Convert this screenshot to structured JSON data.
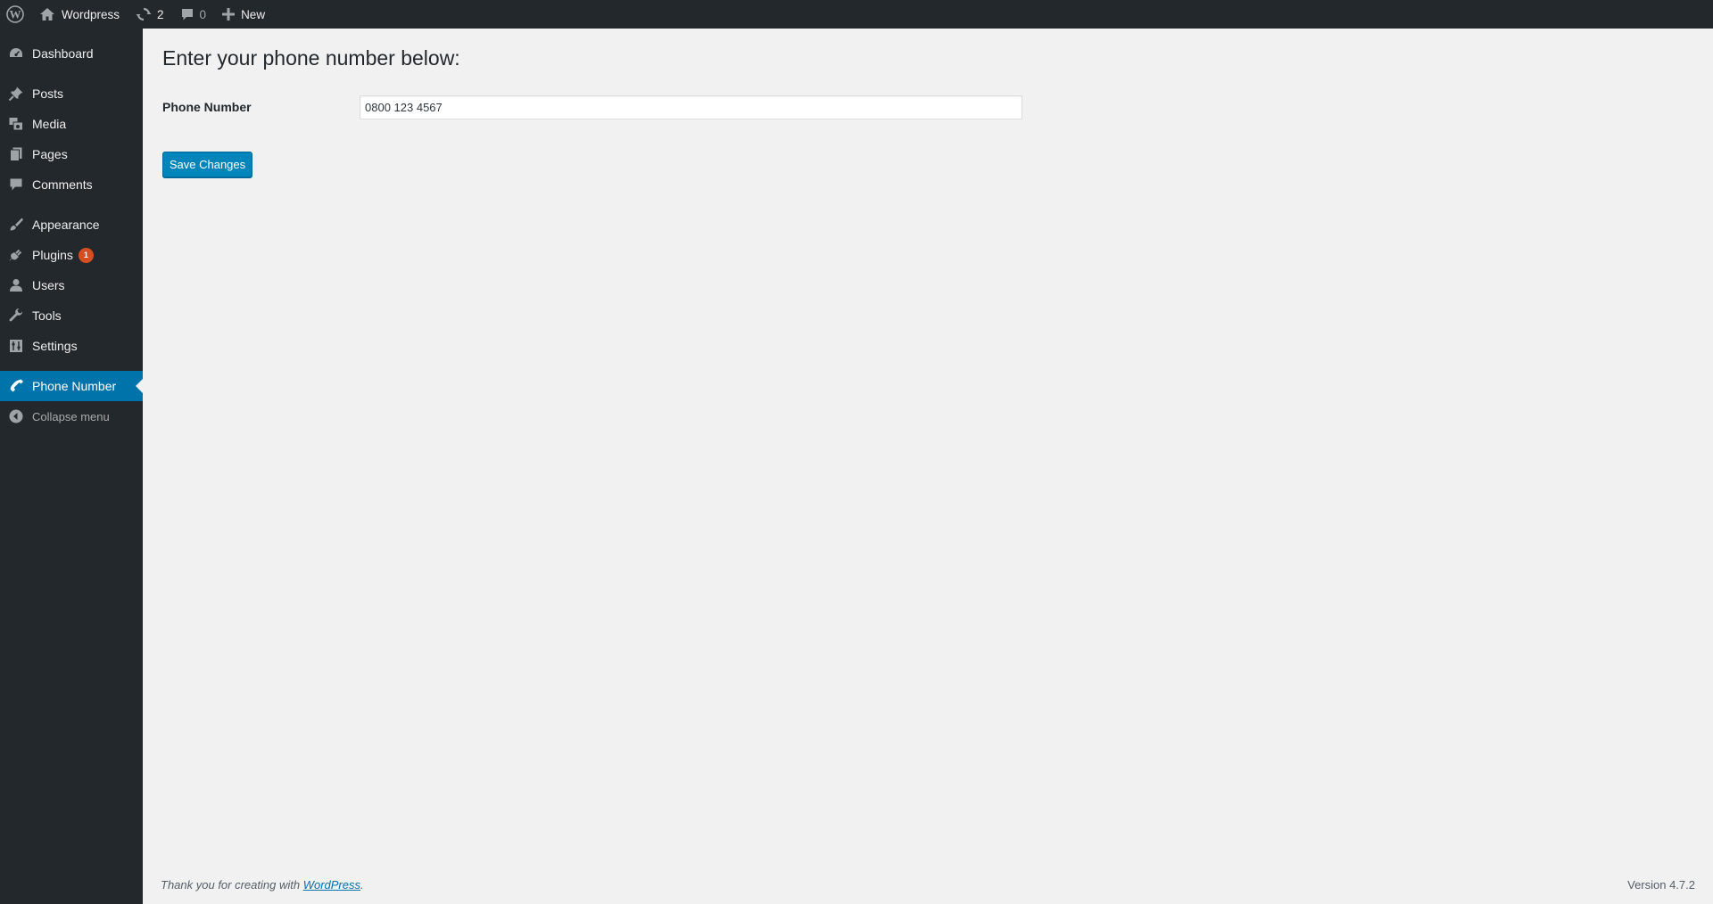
{
  "admin_bar": {
    "site_name": "Wordpress",
    "updates_count": "2",
    "comments_count": "0",
    "new_label": "New"
  },
  "sidebar": {
    "items": [
      {
        "label": "Dashboard",
        "icon": "dashboard-icon"
      },
      {
        "label": "Posts",
        "icon": "pushpin-icon"
      },
      {
        "label": "Media",
        "icon": "media-icon"
      },
      {
        "label": "Pages",
        "icon": "pages-icon"
      },
      {
        "label": "Comments",
        "icon": "comment-bubble-icon"
      },
      {
        "label": "Appearance",
        "icon": "paintbrush-icon"
      },
      {
        "label": "Plugins",
        "icon": "plugin-icon",
        "badge": "1"
      },
      {
        "label": "Users",
        "icon": "user-icon"
      },
      {
        "label": "Tools",
        "icon": "wrench-icon"
      },
      {
        "label": "Settings",
        "icon": "settings-sliders-icon"
      },
      {
        "label": "Phone Number",
        "icon": "phone-icon",
        "current": true
      },
      {
        "label": "Collapse menu",
        "icon": "collapse-arrow-icon"
      }
    ]
  },
  "main": {
    "title": "Enter your phone number below:",
    "phone_label": "Phone Number",
    "phone_value": "0800 123 4567",
    "save_label": "Save Changes"
  },
  "footer": {
    "thank_you_prefix": "Thank you for creating with ",
    "thank_you_link": "WordPress",
    "thank_you_suffix": ".",
    "version": "Version 4.7.2"
  },
  "colors": {
    "admin_bar_bg": "#23282d",
    "sidebar_bg": "#23282d",
    "current_item_bg": "#0073aa",
    "button_bg": "#0085ba",
    "badge_bg": "#d54e21",
    "content_bg": "#f1f1f1"
  }
}
